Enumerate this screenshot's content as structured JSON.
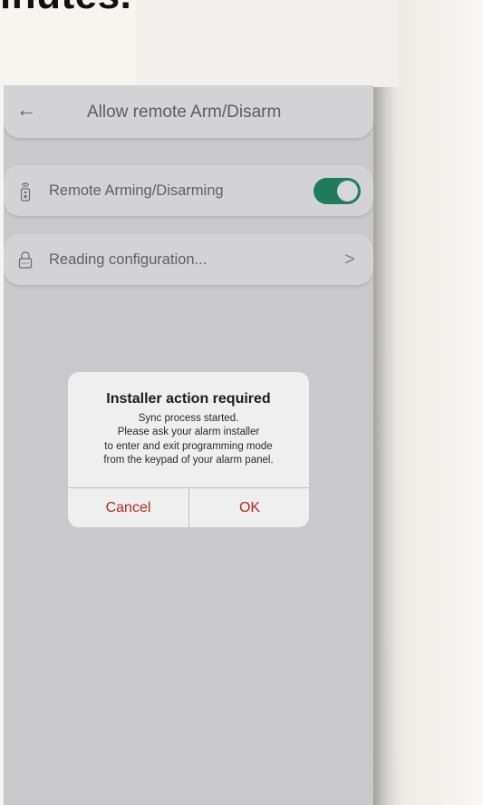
{
  "background": {
    "heading_fragment": "inutes."
  },
  "header": {
    "back_icon": "←",
    "title": "Allow remote Arm/Disarm"
  },
  "rows": [
    {
      "icon": "remote-control-icon",
      "label": "Remote Arming/Disarming",
      "toggle_on": true
    },
    {
      "icon": "lock-icon",
      "label": "Reading configuration...",
      "chevron": ">"
    }
  ],
  "dialog": {
    "title": "Installer action required",
    "body_lines": [
      "Sync process started.",
      "Please ask your alarm installer",
      "to enter and exit programming mode",
      "from the keypad of your alarm panel."
    ],
    "cancel_label": "Cancel",
    "ok_label": "OK"
  },
  "colors": {
    "toggle_on": "#1f7d5e",
    "dialog_button_text": "#b52a1f",
    "overlay_background": "#c9c9cc"
  }
}
